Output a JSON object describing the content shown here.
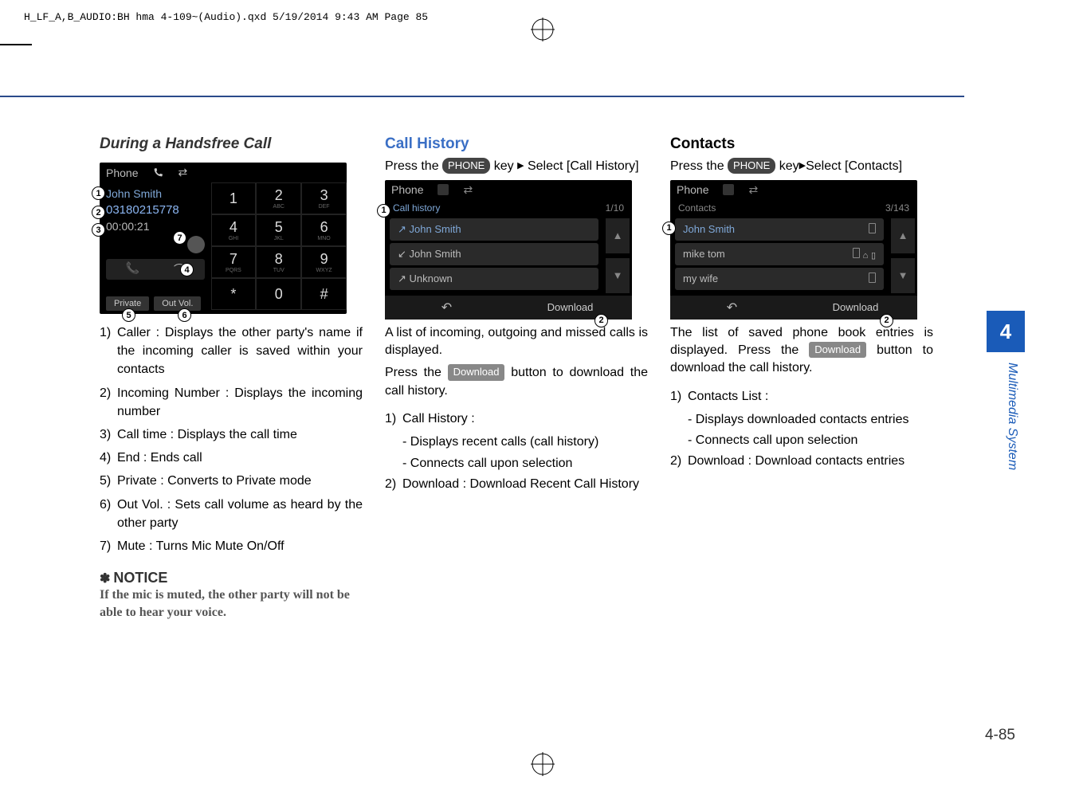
{
  "header": {
    "line": "H_LF_A,B_AUDIO:BH hma 4-109~(Audio).qxd  5/19/2014  9:43 AM  Page 85"
  },
  "sidebar": {
    "chapter": "4",
    "section": "Multimedia System",
    "page": "4-85"
  },
  "col1": {
    "heading": "During a Handsfree Call",
    "screen": {
      "title": "Phone",
      "caller": "John Smith",
      "number": "03180215778",
      "time": "00:00:21",
      "keys": [
        {
          "d": "1",
          "s": ""
        },
        {
          "d": "2",
          "s": "ABC"
        },
        {
          "d": "3",
          "s": "DEF"
        },
        {
          "d": "4",
          "s": "GHI"
        },
        {
          "d": "5",
          "s": "JKL"
        },
        {
          "d": "6",
          "s": "MNO"
        },
        {
          "d": "7",
          "s": "PQRS"
        },
        {
          "d": "8",
          "s": "TUV"
        },
        {
          "d": "9",
          "s": "WXYZ"
        },
        {
          "d": "*",
          "s": ""
        },
        {
          "d": "0",
          "s": ""
        },
        {
          "d": "#",
          "s": ""
        }
      ],
      "private_btn": "Private",
      "outvol_btn": "Out Vol."
    },
    "items": [
      "Caller : Displays the other party's name if the incoming caller is saved within your contacts",
      "Incoming Number : Displays the incoming number",
      "Call time : Displays the call time",
      "End : Ends call",
      "Private : Converts to Private mode",
      "Out Vol. : Sets call volume as heard by the other party",
      "Mute : Turns Mic Mute On/Off"
    ],
    "notice_h": "NOTICE",
    "notice_t": "If the mic is muted, the other party will not be able to hear your voice."
  },
  "col2": {
    "heading": "Call History",
    "intro_pre": "Press the ",
    "phone_pill": "PHONE",
    "intro_mid": " key ",
    "intro_post": " Select [Call History]",
    "screen": {
      "title": "Phone",
      "subtitle": "Call history",
      "count": "1/10",
      "items": [
        "John Smith",
        "John Smith",
        "Unknown"
      ],
      "download": "Download"
    },
    "para1": "A list of incoming, outgoing and missed calls is displayed.",
    "para2_pre": "Press the ",
    "download_pill": "Download",
    "para2_post": " button to download the call history.",
    "l1_h": "Call History :",
    "l1_a": "- Displays recent calls (call history)",
    "l1_b": "- Connects call upon selection",
    "l2": "Download : Download Recent Call History"
  },
  "col3": {
    "heading": "Contacts",
    "intro_pre": "Press the ",
    "phone_pill": "PHONE",
    "intro_mid": " key",
    "intro_post": "Select [Contacts]",
    "screen": {
      "title": "Phone",
      "subtitle": "Contacts",
      "count": "3/143",
      "items": [
        "John Smith",
        "mike tom",
        "my wife"
      ],
      "download": "Download"
    },
    "para1_pre": "The list of saved phone book entries is displayed. Press the ",
    "download_pill": "Download",
    "para1_post": " button to download the call history.",
    "l1_h": "Contacts List :",
    "l1_a": "- Displays downloaded contacts entries",
    "l1_b": "- Connects call upon selection",
    "l2": "Download : Download contacts entries"
  }
}
